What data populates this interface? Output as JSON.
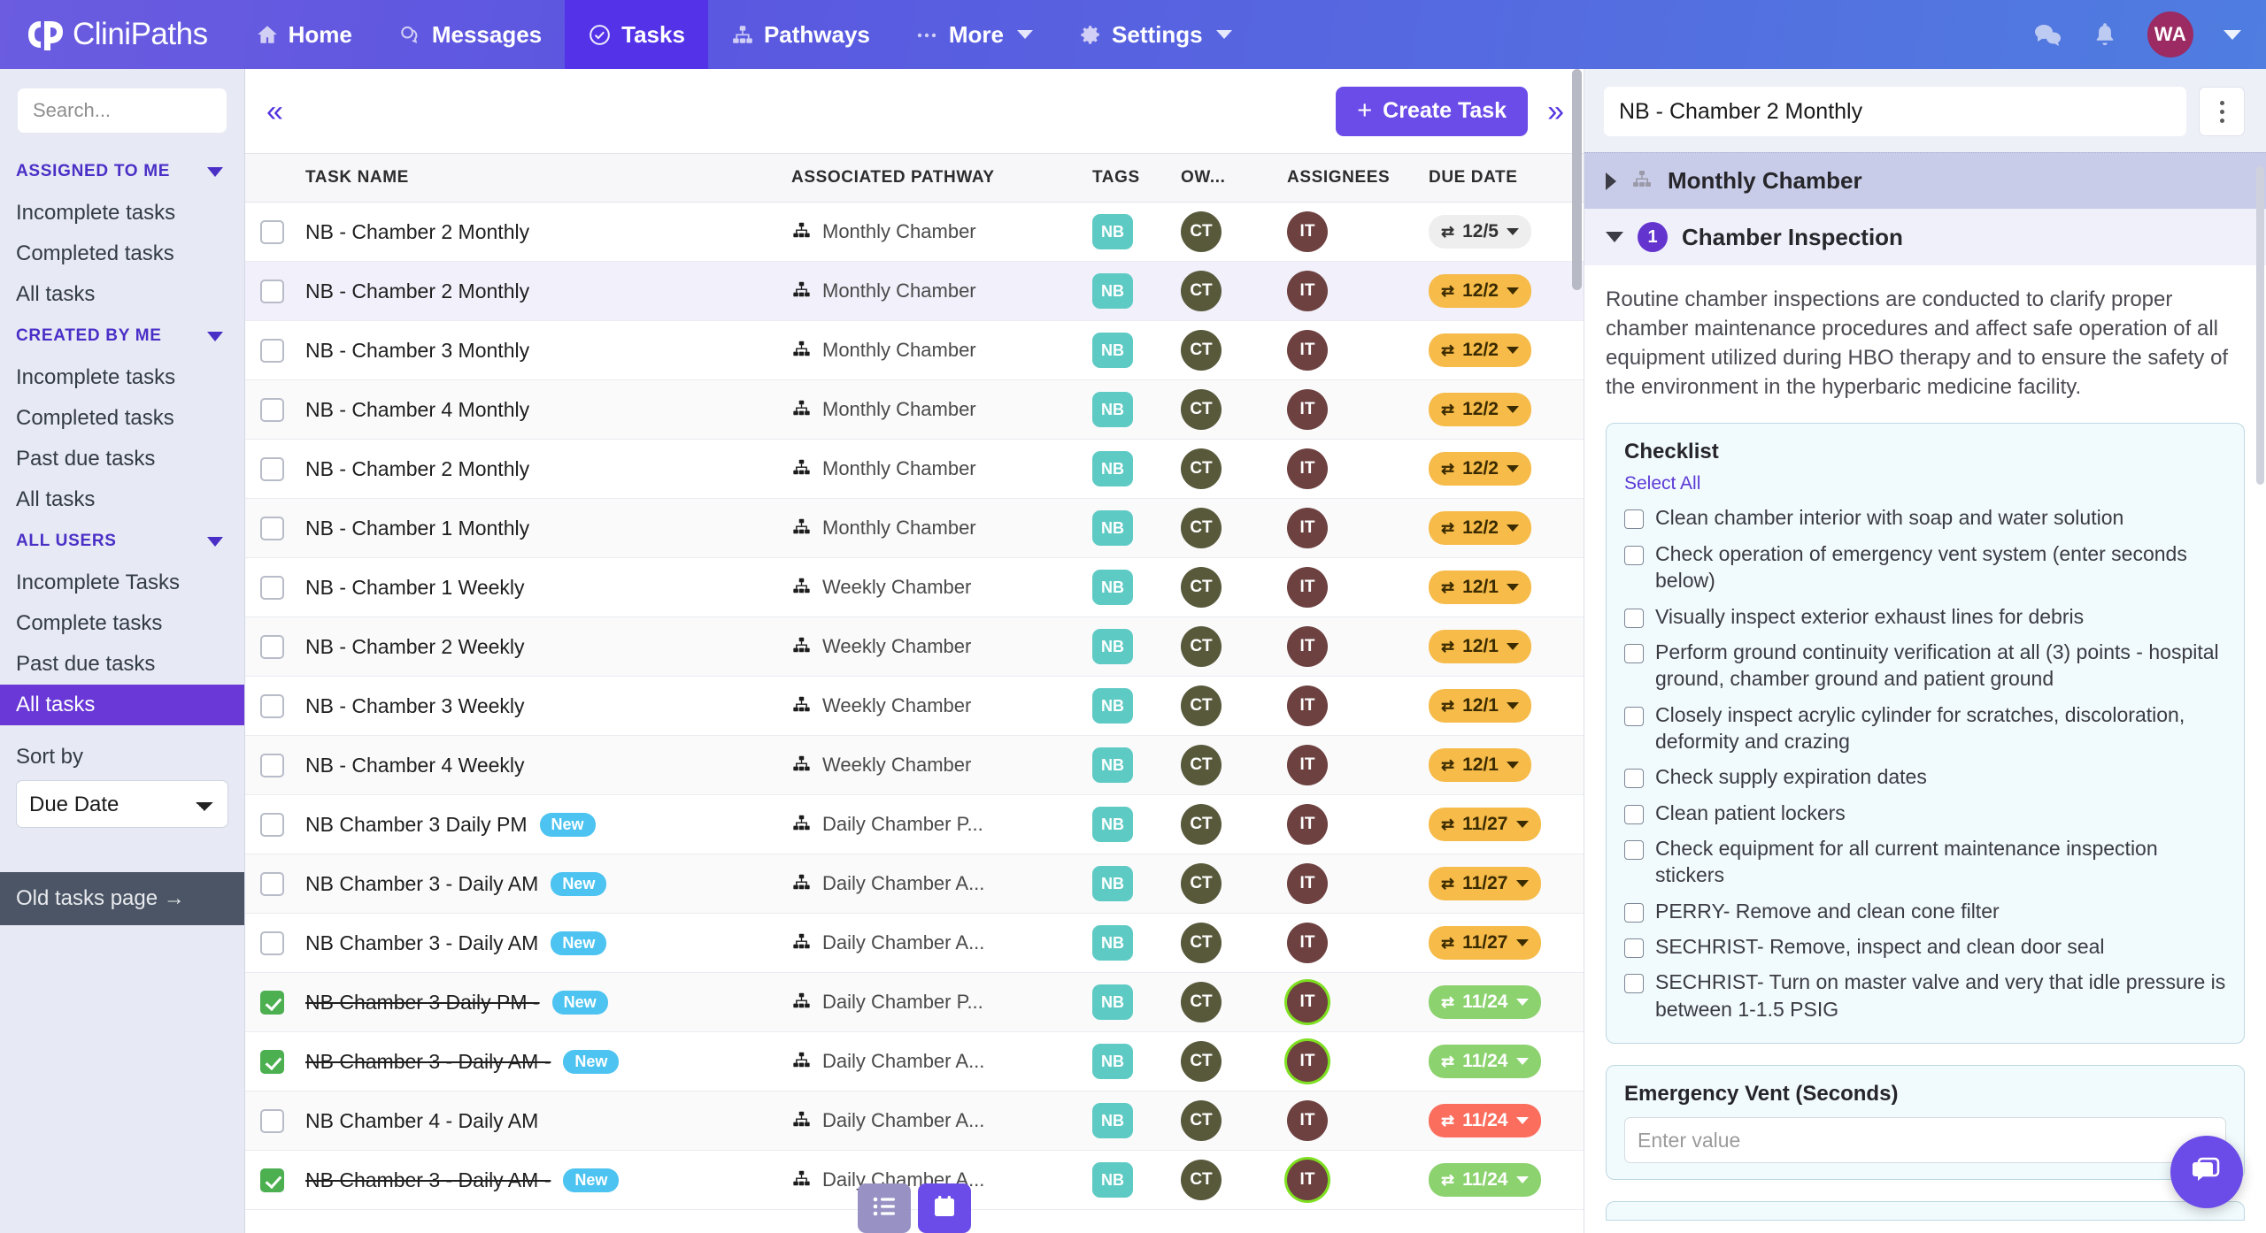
{
  "app": {
    "brand": "CliniPaths",
    "logo_text": "CP",
    "nav": [
      {
        "label": "Home",
        "icon": "home-icon",
        "active": false,
        "caret": false
      },
      {
        "label": "Messages",
        "icon": "messages-icon",
        "active": false,
        "caret": false
      },
      {
        "label": "Tasks",
        "icon": "check-circle-icon",
        "active": true,
        "caret": false
      },
      {
        "label": "Pathways",
        "icon": "sitemap-icon",
        "active": false,
        "caret": false
      },
      {
        "label": "More",
        "icon": "ellipsis-icon",
        "active": false,
        "caret": true
      },
      {
        "label": "Settings",
        "icon": "gear-icon",
        "active": false,
        "caret": true
      }
    ],
    "nav_right": {
      "chat_icon": "chat-bubbles-icon",
      "bell_icon": "bell-icon",
      "avatar_initials": "WA",
      "avatar_color": "#9c2a63"
    },
    "accent": "#6c4ce8",
    "nav_active_bg": "#5332e8"
  },
  "sidebar": {
    "search_placeholder": "Search...",
    "search_value": "",
    "groups": [
      {
        "title": "ASSIGNED TO ME",
        "items": [
          {
            "label": "Incomplete tasks",
            "selected": false
          },
          {
            "label": "Completed tasks",
            "selected": false
          },
          {
            "label": "All tasks",
            "selected": false
          }
        ]
      },
      {
        "title": "CREATED BY ME",
        "items": [
          {
            "label": "Incomplete tasks",
            "selected": false
          },
          {
            "label": "Completed tasks",
            "selected": false
          },
          {
            "label": "Past due tasks",
            "selected": false
          },
          {
            "label": "All tasks",
            "selected": false
          }
        ]
      },
      {
        "title": "ALL USERS",
        "items": [
          {
            "label": "Incomplete Tasks",
            "selected": false
          },
          {
            "label": "Complete tasks",
            "selected": false
          },
          {
            "label": "Past due tasks",
            "selected": false
          },
          {
            "label": "All tasks",
            "selected": true
          }
        ]
      }
    ],
    "sort_by_label": "Sort by",
    "sort_by_value": "Due Date",
    "sort_by_options": [
      "Due Date"
    ],
    "old_tasks_link": "Old tasks page →"
  },
  "tasklist": {
    "collapse_icon": "double-chevron-left-icon",
    "expand_icon": "double-chevron-right-icon",
    "create_button": "Create Task",
    "columns": [
      "TASK NAME",
      "ASSOCIATED PATHWAY",
      "TAGS",
      "OW...",
      "ASSIGNEES",
      "DUE DATE"
    ],
    "rows": [
      {
        "name": "NB - Chamber 2 Monthly",
        "new": false,
        "done": false,
        "pathway": "Monthly Chamber",
        "tag": "NB",
        "owner": "CT",
        "assignee": "IT",
        "due": "12/5",
        "due_style": "grey",
        "assignee_ring": false,
        "row_style": "plain"
      },
      {
        "name": "NB - Chamber 2 Monthly",
        "new": false,
        "done": false,
        "pathway": "Monthly Chamber",
        "tag": "NB",
        "owner": "CT",
        "assignee": "IT",
        "due": "12/2",
        "due_style": "amber",
        "assignee_ring": false,
        "row_style": "hl"
      },
      {
        "name": "NB - Chamber 3 Monthly",
        "new": false,
        "done": false,
        "pathway": "Monthly Chamber",
        "tag": "NB",
        "owner": "CT",
        "assignee": "IT",
        "due": "12/2",
        "due_style": "amber",
        "assignee_ring": false,
        "row_style": "plain"
      },
      {
        "name": "NB - Chamber 4 Monthly",
        "new": false,
        "done": false,
        "pathway": "Monthly Chamber",
        "tag": "NB",
        "owner": "CT",
        "assignee": "IT",
        "due": "12/2",
        "due_style": "amber",
        "assignee_ring": false,
        "row_style": "alt"
      },
      {
        "name": "NB - Chamber 2 Monthly",
        "new": false,
        "done": false,
        "pathway": "Monthly Chamber",
        "tag": "NB",
        "owner": "CT",
        "assignee": "IT",
        "due": "12/2",
        "due_style": "amber",
        "assignee_ring": false,
        "row_style": "plain"
      },
      {
        "name": "NB - Chamber 1 Monthly",
        "new": false,
        "done": false,
        "pathway": "Monthly Chamber",
        "tag": "NB",
        "owner": "CT",
        "assignee": "IT",
        "due": "12/2",
        "due_style": "amber",
        "assignee_ring": false,
        "row_style": "alt"
      },
      {
        "name": "NB - Chamber 1 Weekly",
        "new": false,
        "done": false,
        "pathway": "Weekly Chamber",
        "tag": "NB",
        "owner": "CT",
        "assignee": "IT",
        "due": "12/1",
        "due_style": "amber",
        "assignee_ring": false,
        "row_style": "plain"
      },
      {
        "name": "NB - Chamber 2 Weekly",
        "new": false,
        "done": false,
        "pathway": "Weekly Chamber",
        "tag": "NB",
        "owner": "CT",
        "assignee": "IT",
        "due": "12/1",
        "due_style": "amber",
        "assignee_ring": false,
        "row_style": "alt"
      },
      {
        "name": "NB - Chamber 3 Weekly",
        "new": false,
        "done": false,
        "pathway": "Weekly Chamber",
        "tag": "NB",
        "owner": "CT",
        "assignee": "IT",
        "due": "12/1",
        "due_style": "amber",
        "assignee_ring": false,
        "row_style": "plain"
      },
      {
        "name": "NB - Chamber 4 Weekly",
        "new": false,
        "done": false,
        "pathway": "Weekly Chamber",
        "tag": "NB",
        "owner": "CT",
        "assignee": "IT",
        "due": "12/1",
        "due_style": "amber",
        "assignee_ring": false,
        "row_style": "alt"
      },
      {
        "name": "NB Chamber 3 Daily PM",
        "new": true,
        "done": false,
        "pathway": "Daily Chamber P...",
        "tag": "NB",
        "owner": "CT",
        "assignee": "IT",
        "due": "11/27",
        "due_style": "amber",
        "assignee_ring": false,
        "row_style": "plain"
      },
      {
        "name": "NB Chamber 3 - Daily AM",
        "new": true,
        "done": false,
        "pathway": "Daily Chamber A...",
        "tag": "NB",
        "owner": "CT",
        "assignee": "IT",
        "due": "11/27",
        "due_style": "amber",
        "assignee_ring": false,
        "row_style": "alt"
      },
      {
        "name": "NB Chamber 3 - Daily AM",
        "new": true,
        "done": false,
        "pathway": "Daily Chamber A...",
        "tag": "NB",
        "owner": "CT",
        "assignee": "IT",
        "due": "11/27",
        "due_style": "amber",
        "assignee_ring": false,
        "row_style": "plain"
      },
      {
        "name": "NB Chamber 3 Daily PM -",
        "new": true,
        "done": true,
        "pathway": "Daily Chamber P...",
        "tag": "NB",
        "owner": "CT",
        "assignee": "IT",
        "due": "11/24",
        "due_style": "green",
        "assignee_ring": true,
        "row_style": "alt"
      },
      {
        "name": "NB Chamber 3 - Daily AM -",
        "new": true,
        "done": true,
        "pathway": "Daily Chamber A...",
        "tag": "NB",
        "owner": "CT",
        "assignee": "IT",
        "due": "11/24",
        "due_style": "green",
        "assignee_ring": true,
        "row_style": "plain"
      },
      {
        "name": "NB Chamber 4 - Daily AM",
        "new": false,
        "done": false,
        "pathway": "Daily Chamber A...",
        "tag": "NB",
        "owner": "CT",
        "assignee": "IT",
        "due": "11/24",
        "due_style": "red",
        "assignee_ring": false,
        "row_style": "alt"
      },
      {
        "name": "NB Chamber 3 - Daily AM -",
        "new": true,
        "done": true,
        "pathway": "Daily Chamber A...",
        "tag": "NB",
        "owner": "CT",
        "assignee": "IT",
        "due": "11/24",
        "due_style": "green",
        "assignee_ring": true,
        "row_style": "plain"
      }
    ],
    "view_toggle": [
      {
        "name": "list-view",
        "icon": "list-icon",
        "active": false
      },
      {
        "name": "calendar-view",
        "icon": "calendar-icon",
        "active": true
      }
    ],
    "colors": {
      "tag": "#5ecac4",
      "owner_avatar": "#58593b",
      "assignee_avatar": "#6d4140",
      "new_badge": "#4cc3f0",
      "due_amber": "#f6bb49",
      "due_green": "#8cd26f",
      "due_red": "#fb6d5d",
      "due_grey": "#eeeeee"
    }
  },
  "detail": {
    "title_value": "NB - Chamber 2 Monthly",
    "kebab": "more-options-icon",
    "pathway_row": {
      "label": "Monthly Chamber",
      "icon": "sitemap-icon",
      "expanded": false
    },
    "section_row": {
      "number": "1",
      "label": "Chamber Inspection",
      "expanded": true
    },
    "description": "Routine chamber inspections are conducted to clarify proper chamber maintenance procedures and affect safe operation of all equipment utilized during HBO therapy and to ensure the safety of the environment in the hyperbaric medicine facility.",
    "checklist": {
      "title": "Checklist",
      "select_all": "Select All",
      "items": [
        {
          "label": "Clean chamber interior with soap and water solution",
          "checked": false
        },
        {
          "label": "Check operation of emergency vent system (enter seconds below)",
          "checked": false
        },
        {
          "label": "Visually inspect exterior exhaust lines for debris",
          "checked": false
        },
        {
          "label": "Perform ground continuity verification at all (3) points - hospital ground, chamber ground and patient ground",
          "checked": false
        },
        {
          "label": "Closely inspect acrylic cylinder for scratches, discoloration, deformity and crazing",
          "checked": false
        },
        {
          "label": "Check supply expiration dates",
          "checked": false
        },
        {
          "label": "Clean patient lockers",
          "checked": false
        },
        {
          "label": "Check equipment for all current maintenance inspection stickers",
          "checked": false
        },
        {
          "label": "PERRY- Remove and clean cone filter",
          "checked": false
        },
        {
          "label": "SECHRIST- Remove, inspect and clean door seal",
          "checked": false
        },
        {
          "label": "SECHRIST- Turn on master valve and very that idle pressure is between 1-1.5 PSIG",
          "checked": false
        }
      ]
    },
    "vent_field": {
      "label": "Emergency Vent (Seconds)",
      "placeholder": "Enter value",
      "value": ""
    },
    "chat_fab": "chat-icon"
  }
}
